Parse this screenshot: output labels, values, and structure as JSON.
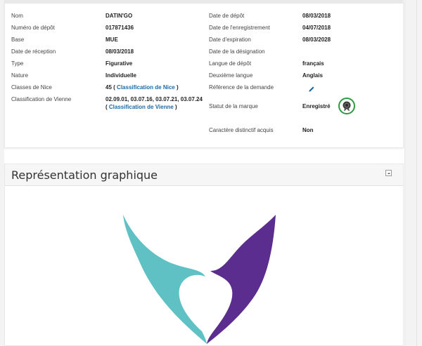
{
  "details": {
    "left_rows": [
      {
        "label": "Nom",
        "value": "DATIN'GO"
      },
      {
        "label": "Numéro de dépôt",
        "value": "017871436"
      },
      {
        "label": "Base",
        "value": "MUE"
      },
      {
        "label": "Date de réception",
        "value": "08/03/2018"
      },
      {
        "label": "Type",
        "value": "Figurative"
      },
      {
        "label": "Nature",
        "value": "Individuelle"
      }
    ],
    "nice": {
      "label": "Classes de Nice",
      "value": "45",
      "open": "(",
      "link": "Classification de Nice",
      "close": ")"
    },
    "vienna": {
      "label": "Classification de Vienne",
      "value": "02.09.01, 03.07.16, 03.07.21, 03.07.24",
      "open": "(",
      "link": "Classification de Vienne",
      "close": ")"
    },
    "right_rows": [
      {
        "label": "Date de dépôt",
        "value": "08/03/2018"
      },
      {
        "label": "Date de l'enregistrement",
        "value": "04/07/2018"
      },
      {
        "label": "Date d'expiration",
        "value": "08/03/2028"
      },
      {
        "label": "Date de la désignation",
        "value": ""
      },
      {
        "label": "Langue de dépôt",
        "value": "français"
      },
      {
        "label": "Deuxième langue",
        "value": "Anglais"
      }
    ],
    "reference": {
      "label": "Référence de la demande",
      "icon": "pencil-icon"
    },
    "status": {
      "label": "Statut de la marque",
      "value": "Enregistré",
      "icon": "ribbon-icon",
      "badge_color": "#2e9a3e"
    },
    "distinctive": {
      "label": "Caractère distinctif acquis",
      "value": "Non"
    }
  },
  "graphic": {
    "title": "Représentation graphique",
    "collapse_icon": "chevron-up-icon",
    "logo": {
      "description": "two wings forming a heart",
      "left_color": "#5fc1c3",
      "right_color": "#5b2d8e"
    }
  },
  "colors": {
    "link": "#1a6aa8",
    "panel_border": "#e8e8e8"
  }
}
